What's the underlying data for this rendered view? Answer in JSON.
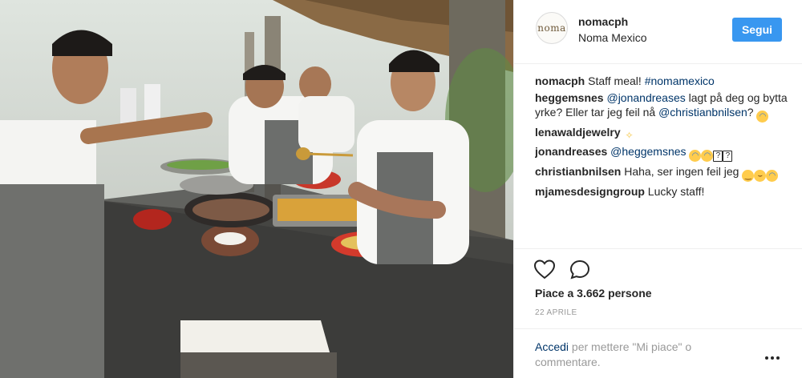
{
  "post": {
    "username": "nomacph",
    "location": "Noma Mexico",
    "avatar_text": "noma",
    "follow_label": "Segui"
  },
  "comments": [
    {
      "author": "nomacph",
      "parts": [
        {
          "t": "text",
          "v": " Staff meal! "
        },
        {
          "t": "hashtag",
          "v": "#nomamexico"
        }
      ]
    },
    {
      "author": "heggemsnes",
      "parts": [
        {
          "t": "text",
          "v": " "
        },
        {
          "t": "link",
          "v": "@jonandreases"
        },
        {
          "t": "text",
          "v": " lagt på deg og bytta yrke? Eller tar jeg feil nå "
        },
        {
          "t": "link",
          "v": "@christianbnilsen"
        },
        {
          "t": "text",
          "v": "? "
        },
        {
          "t": "emoji",
          "v": "laugh"
        }
      ]
    },
    {
      "author": "lenawaldjewelry",
      "parts": [
        {
          "t": "text",
          "v": " "
        },
        {
          "t": "emoji",
          "v": "clap"
        }
      ]
    },
    {
      "author": "jonandreases",
      "parts": [
        {
          "t": "text",
          "v": " "
        },
        {
          "t": "link",
          "v": "@heggemsnes"
        },
        {
          "t": "text",
          "v": " "
        },
        {
          "t": "emoji",
          "v": "laugh"
        },
        {
          "t": "emoji",
          "v": "laugh"
        },
        {
          "t": "emoji",
          "v": "box"
        },
        {
          "t": "emoji",
          "v": "box"
        }
      ]
    },
    {
      "author": "christianbnilsen",
      "parts": [
        {
          "t": "text",
          "v": " Haha, ser ingen feil jeg "
        },
        {
          "t": "emoji",
          "v": "smile"
        },
        {
          "t": "emoji",
          "v": "grin"
        },
        {
          "t": "emoji",
          "v": "laugh"
        }
      ]
    },
    {
      "author": "mjamesdesigngroup",
      "parts": [
        {
          "t": "text",
          "v": " Lucky staff!"
        }
      ]
    }
  ],
  "icons": {
    "like": "heart-icon",
    "comment": "comment-icon",
    "more": "more-options-icon"
  },
  "stats": {
    "likes_text": "Piace a 3.662 persone",
    "date_text": "22 APRILE"
  },
  "login": {
    "link_text": "Accedi",
    "rest_text": " per mettere \"Mi piace\" o commentare."
  },
  "colors": {
    "accent": "#3897f0",
    "link": "#003569",
    "secondary_text": "#999999"
  }
}
